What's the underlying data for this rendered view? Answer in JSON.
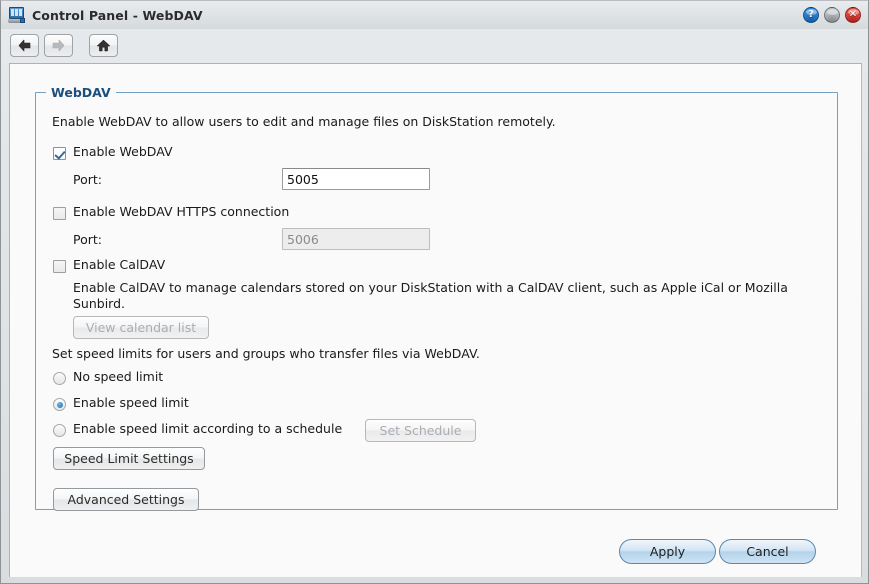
{
  "window": {
    "title": "Control Panel - WebDAV",
    "icon": "control-panel-icon",
    "buttons": {
      "help": "?",
      "minimize": "",
      "close": "✕"
    }
  },
  "nav": {
    "back": "back-arrow-icon",
    "forward": "forward-arrow-icon",
    "home": "home-icon"
  },
  "panel": {
    "legend": "WebDAV",
    "description": "Enable WebDAV to allow users to edit and manage files on DiskStation remotely.",
    "enable_webdav": {
      "label": "Enable WebDAV",
      "checked": true
    },
    "port_label": "Port:",
    "port_value": "5005",
    "enable_https": {
      "label": "Enable WebDAV HTTPS connection",
      "checked": false
    },
    "https_port_label": "Port:",
    "https_port_value": "5006",
    "enable_caldav": {
      "label": "Enable CalDAV",
      "checked": false
    },
    "caldav_description": "Enable CalDAV to manage calendars stored on your DiskStation with a CalDAV client, such as Apple iCal or Mozilla Sunbird.",
    "view_calendar_button": "View calendar list",
    "speed_intro": "Set speed limits for users and groups who transfer files via WebDAV.",
    "speed_options": [
      {
        "label": "No speed limit",
        "selected": false
      },
      {
        "label": "Enable speed limit",
        "selected": true
      },
      {
        "label": "Enable speed limit according to a schedule",
        "selected": false
      }
    ],
    "set_schedule_button": "Set Schedule",
    "speed_limit_settings_button": "Speed Limit Settings",
    "advanced_settings_button": "Advanced Settings"
  },
  "footer": {
    "apply": "Apply",
    "cancel": "Cancel"
  },
  "colors": {
    "accent": "#2e6ca6",
    "panel_border": "#74a0c4",
    "legend_text": "#1c4f7c"
  }
}
